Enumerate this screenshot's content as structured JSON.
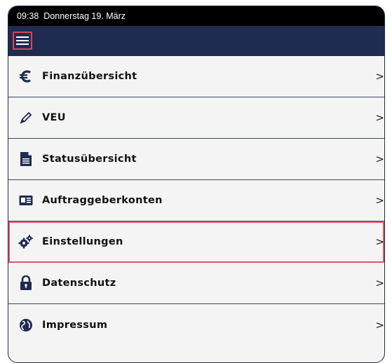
{
  "status_bar": {
    "time": "09:38",
    "date": "Donnerstag 19. März"
  },
  "nav": {
    "menu_icon": "hamburger-menu-icon"
  },
  "menu_items": [
    {
      "label": "Finanzübersicht",
      "icon": "euro-icon"
    },
    {
      "label": "VEU",
      "icon": "pen-icon"
    },
    {
      "label": "Statusübersicht",
      "icon": "document-icon"
    },
    {
      "label": "Auftraggeberkonten",
      "icon": "id-card-icon"
    },
    {
      "label": "Einstellungen",
      "icon": "gears-icon",
      "highlighted": true
    },
    {
      "label": "Datenschutz",
      "icon": "lock-icon"
    },
    {
      "label": "Impressum",
      "icon": "globe-icon"
    }
  ],
  "chevron": ">",
  "colors": {
    "navbar": "#1f2b50",
    "highlight": "#e0566a",
    "statusbar": "#000000"
  }
}
